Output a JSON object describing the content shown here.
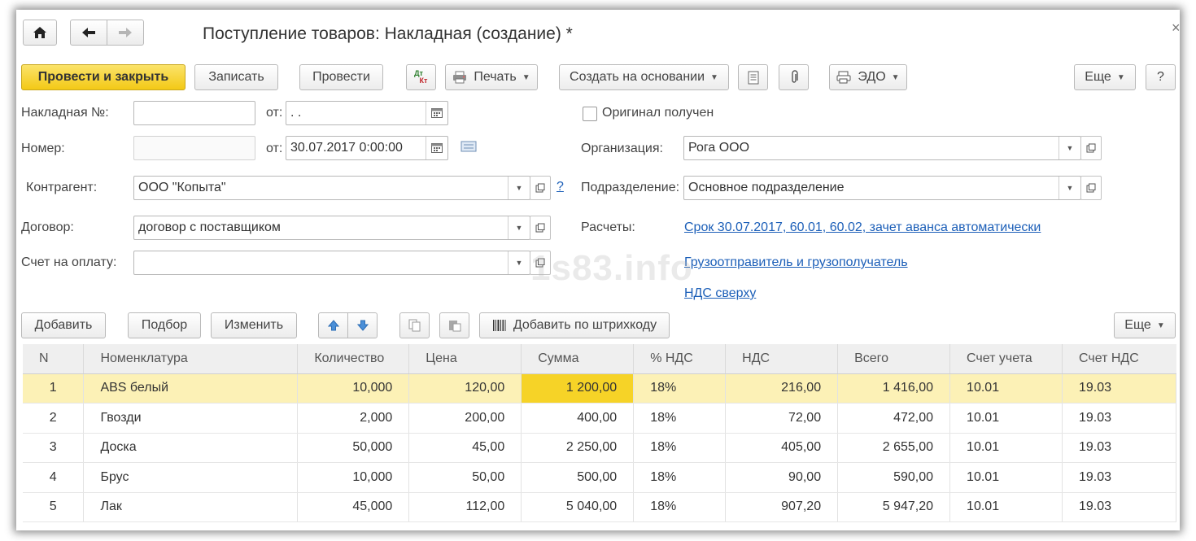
{
  "window": {
    "title": "Поступление товаров: Накладная (создание) *",
    "home_icon": "home-icon",
    "back_icon": "arrow-left-icon",
    "forward_icon": "arrow-right-icon",
    "close_glyph": "×"
  },
  "toolbar": {
    "post_close": "Провести и закрыть",
    "save": "Записать",
    "post": "Провести",
    "dtkt_top": "Дт",
    "dtkt_bottom": "Кт",
    "print": "Печать",
    "create_based": "Создать на основании",
    "edo": "ЭДО",
    "more": "Еще",
    "help": "?"
  },
  "form": {
    "invoice_no_label": "Накладная №:",
    "invoice_no_value": "",
    "from_label": "от:",
    "invoice_date_value": " .  .",
    "number_label": "Номер:",
    "number_value": "",
    "from_label2": "от:",
    "date_value": "30.07.2017  0:00:00",
    "original_label": "Оригинал получен",
    "organization_label": "Организация:",
    "organization_value": "Рога ООО",
    "counterparty_label": "Контрагент:",
    "counterparty_value": "ООО \"Копыта\"",
    "counterparty_help": "?",
    "division_label": "Подразделение:",
    "division_value": "Основное подразделение",
    "contract_label": "Договор:",
    "contract_value": "договор с поставщиком",
    "settlements_label": "Расчеты:",
    "settlements_link": "Срок 30.07.2017, 60.01, 60.02, зачет аванса автоматически",
    "payment_invoice_label": "Счет на оплату:",
    "payment_invoice_value": "",
    "shipper_link": "Грузоотправитель и грузополучатель",
    "vat_link": "НДС сверху",
    "watermark": "1s83.info"
  },
  "table_toolbar": {
    "add": "Добавить",
    "pick": "Подбор",
    "edit": "Изменить",
    "barcode": "Добавить по штрихкоду",
    "more": "Еще"
  },
  "table": {
    "columns": [
      "N",
      "Номенклатура",
      "Количество",
      "Цена",
      "Сумма",
      "% НДС",
      "НДС",
      "Всего",
      "Счет учета",
      "Счет НДС"
    ],
    "rows": [
      [
        "1",
        "ABS белый",
        "10,000",
        "120,00",
        "1 200,00",
        "18%",
        "216,00",
        "1 416,00",
        "10.01",
        "19.03"
      ],
      [
        "2",
        "Гвозди",
        "2,000",
        "200,00",
        "400,00",
        "18%",
        "72,00",
        "472,00",
        "10.01",
        "19.03"
      ],
      [
        "3",
        "Доска",
        "50,000",
        "45,00",
        "2 250,00",
        "18%",
        "405,00",
        "2 655,00",
        "10.01",
        "19.03"
      ],
      [
        "4",
        "Брус",
        "10,000",
        "50,00",
        "500,00",
        "18%",
        "90,00",
        "590,00",
        "10.01",
        "19.03"
      ],
      [
        "5",
        "Лак",
        "45,000",
        "112,00",
        "5 040,00",
        "18%",
        "907,20",
        "5 947,20",
        "10.01",
        "19.03"
      ]
    ]
  },
  "colors": {
    "primary_button": "#f5cf25",
    "selected_row": "#fcf1b6",
    "current_cell": "#f6d327",
    "link": "#1c5fb8"
  }
}
